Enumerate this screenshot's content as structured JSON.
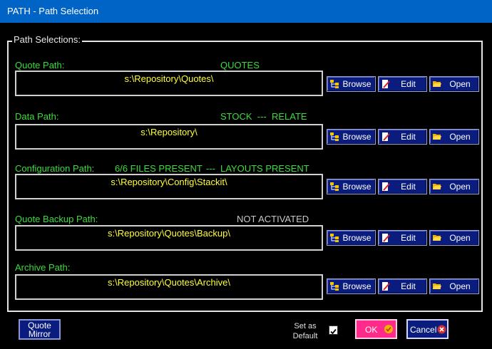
{
  "window": {
    "title": "PATH - Path Selection"
  },
  "group": {
    "label": "Path Selections:"
  },
  "sections": [
    {
      "label": "Quote Path:",
      "status": "QUOTES",
      "value": "s:\\Repository\\Quotes\\"
    },
    {
      "label": "Data Path:",
      "status": "STOCK  ---  RELATE",
      "value": "s:\\Repository\\"
    },
    {
      "label": "Configuration Path:",
      "status_left": "6/6 FILES PRESENT",
      "status_sep": "---",
      "status_right": "LAYOUTS PRESENT",
      "value": "s:\\Repository\\Config\\Stackit\\"
    },
    {
      "label": "Quote Backup Path:",
      "status": "NOT ACTIVATED",
      "value": "s:\\Repository\\Quotes\\Backup\\"
    },
    {
      "label": "Archive Path:",
      "value": "s:\\Repository\\Quotes\\Archive\\"
    }
  ],
  "buttons": {
    "browse": "Browse",
    "edit": "Edit",
    "open": "Open"
  },
  "footer": {
    "quote_mirror_line1": "Quote",
    "quote_mirror_line2": "Mirror",
    "set_as_line1": "Set as",
    "set_as_line2": "Default",
    "ok": "OK",
    "cancel": "Cancel"
  },
  "colors": {
    "title_bar": "#0063c6",
    "label_green": "#3cdc3c",
    "value_yellow": "#ffff33",
    "button_navy": "#0a1d7e",
    "ok_pink": "#ff2a8a"
  }
}
